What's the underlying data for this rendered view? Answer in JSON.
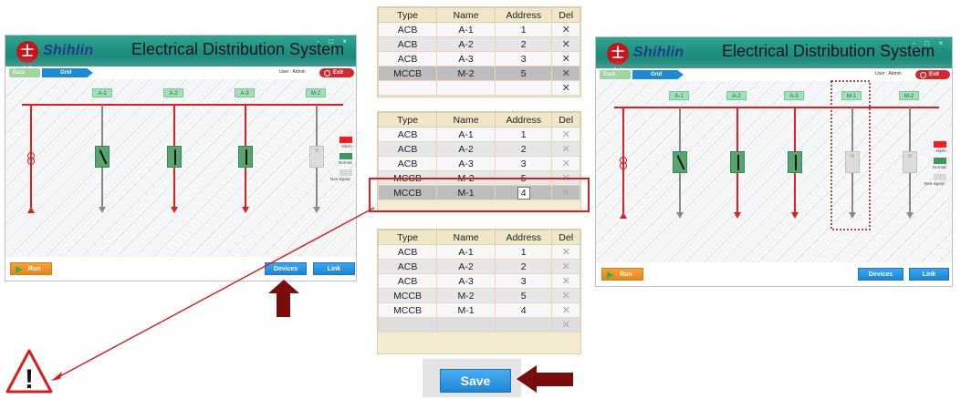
{
  "app": {
    "brand": "Shihlin",
    "title": "Electrical Distribution System",
    "logo_text": "士林",
    "window_controls": "- □ ×"
  },
  "nav": {
    "back_label": "Back",
    "grid_tab": "Grid",
    "user_label": "User :",
    "user_name": "Admin",
    "exit_label": "Exit"
  },
  "left_window": {
    "bus_labels": [
      "A-1",
      "A-2",
      "A-3",
      "M-2"
    ],
    "run_label": "Run",
    "devices_label": "Devices",
    "link_label": "Link"
  },
  "right_window": {
    "bus_labels": [
      "A-1",
      "A-2",
      "A-3",
      "M-1",
      "M-2"
    ],
    "run_label": "Run",
    "devices_label": "Devices",
    "link_label": "Link"
  },
  "legend": {
    "alarm": "Alarm",
    "normal": "Normal",
    "nonsignal": "Non-signal",
    "alarm_color": "#ff1a1a",
    "normal_color": "#3a9a5c",
    "nonsignal_color": "#d8d8d8"
  },
  "table_headers": [
    "Type",
    "Name",
    "Address",
    "Del"
  ],
  "table1": {
    "rows": [
      {
        "type": "ACB",
        "name": "A-1",
        "address": "1",
        "del": "✕"
      },
      {
        "type": "ACB",
        "name": "A-2",
        "address": "2",
        "del": "✕"
      },
      {
        "type": "ACB",
        "name": "A-3",
        "address": "3",
        "del": "✕"
      },
      {
        "type": "MCCB",
        "name": "M-2",
        "address": "5",
        "del": "✕"
      },
      {
        "type": "",
        "name": "",
        "address": "",
        "del": "✕"
      }
    ]
  },
  "table2": {
    "rows": [
      {
        "type": "ACB",
        "name": "A-1",
        "address": "1",
        "del": "✕"
      },
      {
        "type": "ACB",
        "name": "A-2",
        "address": "2",
        "del": "✕"
      },
      {
        "type": "ACB",
        "name": "A-3",
        "address": "3",
        "del": "✕"
      },
      {
        "type": "MCCB",
        "name": "M-2",
        "address": "5",
        "del": "✕"
      },
      {
        "type": "MCCB",
        "name": "M-1",
        "address": "4",
        "del": "✕"
      }
    ]
  },
  "table3": {
    "rows": [
      {
        "type": "ACB",
        "name": "A-1",
        "address": "1",
        "del": "✕"
      },
      {
        "type": "ACB",
        "name": "A-2",
        "address": "2",
        "del": "✕"
      },
      {
        "type": "ACB",
        "name": "A-3",
        "address": "3",
        "del": "✕"
      },
      {
        "type": "MCCB",
        "name": "M-2",
        "address": "5",
        "del": "✕"
      },
      {
        "type": "MCCB",
        "name": "M-1",
        "address": "4",
        "del": "✕"
      },
      {
        "type": "",
        "name": "",
        "address": "",
        "del": "✕"
      }
    ]
  },
  "save_label": "Save",
  "warning_symbol": "!",
  "colors": {
    "annotation_red": "#d91e1e",
    "dark_red_arrow": "#7a0c0c",
    "title_teal": "#1d8f7d",
    "button_blue": "#1c86d6",
    "run_orange": "#f39220"
  }
}
